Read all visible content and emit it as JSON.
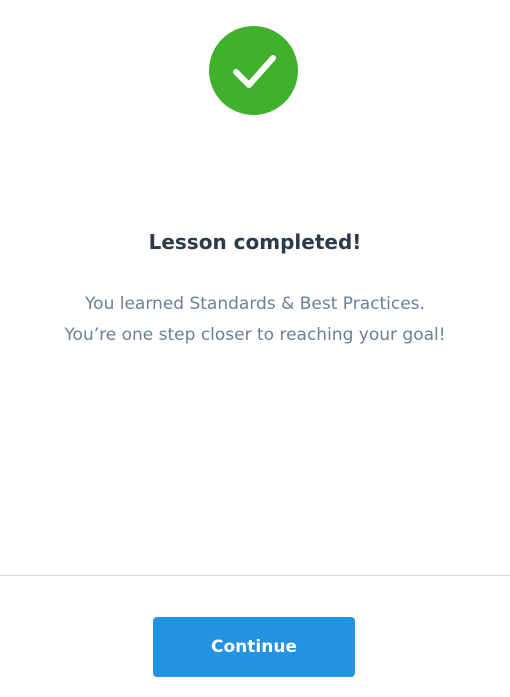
{
  "status": {
    "icon": "checkmark-icon",
    "color": "#3fb12b"
  },
  "title": "Lesson completed!",
  "message": {
    "line1": "You learned Standards & Best Practices.",
    "line2": "You’re one step closer to reaching your goal!"
  },
  "footer": {
    "continue_label": "Continue",
    "button_color": "#2392e0"
  }
}
